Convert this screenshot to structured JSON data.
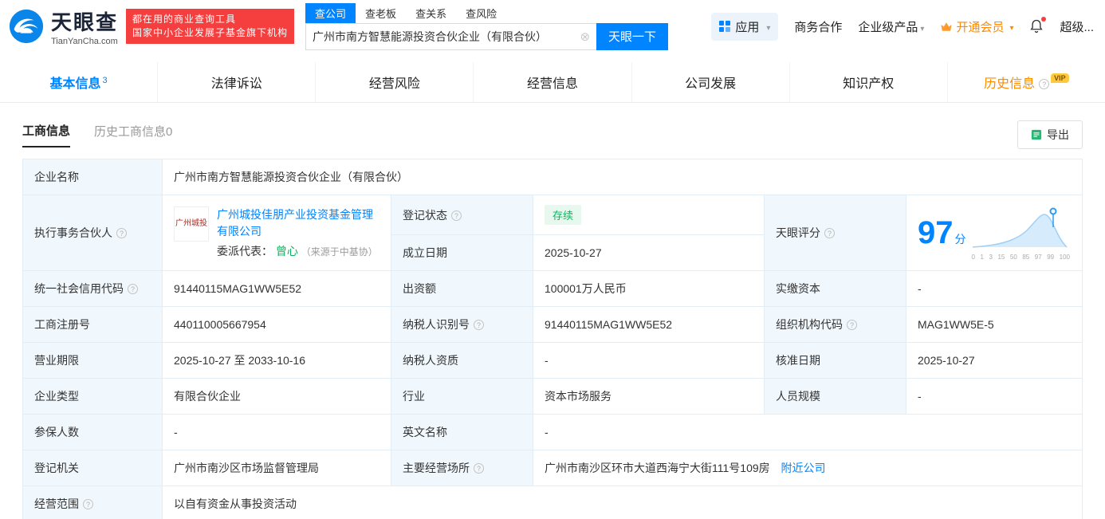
{
  "header": {
    "logo": {
      "name": "天眼查",
      "domain": "TianYanCha.com"
    },
    "slogan1": "都在用的商业查询工具",
    "slogan2": "国家中小企业发展子基金旗下机构",
    "search_tabs": [
      "查公司",
      "查老板",
      "查关系",
      "查风险"
    ],
    "search": {
      "value": "广州市南方智慧能源投资合伙企业（有限合伙）",
      "button": "天眼一下"
    },
    "nav": {
      "apps": "应用",
      "biz_cooperation": "商务合作",
      "enterprise_product": "企业级产品",
      "open_vip": "开通会员",
      "super": "超级..."
    }
  },
  "tabs": [
    {
      "label": "基本信息",
      "count": "3"
    },
    {
      "label": "法律诉讼"
    },
    {
      "label": "经营风险"
    },
    {
      "label": "经营信息"
    },
    {
      "label": "公司发展"
    },
    {
      "label": "知识产权"
    },
    {
      "label": "历史信息",
      "badge": "VIP"
    }
  ],
  "subtabs": [
    "工商信息",
    "历史工商信息0"
  ],
  "export_label": "导出",
  "info": {
    "company_name": {
      "label": "企业名称",
      "value": "广州市南方智慧能源投资合伙企业（有限合伙）"
    },
    "partner": {
      "label": "执行事务合伙人",
      "logo_text": "广州城投",
      "company": "广州城投佳朋产业投资基金管理有限公司",
      "rep_label": "委派代表：",
      "rep_name": "曾心",
      "rep_source": "（来源于中基协）"
    },
    "reg_status": {
      "label": "登记状态",
      "value": "存续"
    },
    "establish_date": {
      "label": "成立日期",
      "value": "2025-10-27"
    },
    "score": {
      "label": "天眼评分",
      "value": "97",
      "unit": "分",
      "axis": [
        "0",
        "1",
        "3",
        "15",
        "50",
        "85",
        "97",
        "99",
        "100"
      ]
    },
    "credit_code": {
      "label": "统一社会信用代码",
      "value": "91440115MAG1WW5E52"
    },
    "capital": {
      "label": "出资额",
      "value": "100001万人民币"
    },
    "paid_capital": {
      "label": "实缴资本",
      "value": "-"
    },
    "reg_number": {
      "label": "工商注册号",
      "value": "440110005667954"
    },
    "taxpayer_id": {
      "label": "纳税人识别号",
      "value": "91440115MAG1WW5E52"
    },
    "org_code": {
      "label": "组织机构代码",
      "value": "MAG1WW5E-5"
    },
    "business_term": {
      "label": "营业期限",
      "value": "2025-10-27 至 2033-10-16"
    },
    "taxpayer_quality": {
      "label": "纳税人资质",
      "value": "-"
    },
    "approval_date": {
      "label": "核准日期",
      "value": "2025-10-27"
    },
    "company_type": {
      "label": "企业类型",
      "value": "有限合伙企业"
    },
    "industry": {
      "label": "行业",
      "value": "资本市场服务"
    },
    "staff_size": {
      "label": "人员规模",
      "value": "-"
    },
    "insured_count": {
      "label": "参保人数",
      "value": "-"
    },
    "english_name": {
      "label": "英文名称",
      "value": "-"
    },
    "reg_authority": {
      "label": "登记机关",
      "value": "广州市南沙区市场监督管理局"
    },
    "business_address": {
      "label": "主要经营场所",
      "value": "广州市南沙区环市大道西海宁大街111号109房",
      "nearby": "附近公司"
    },
    "business_scope": {
      "label": "经营范围",
      "value": "以自有资金从事投资活动"
    }
  },
  "colors": {
    "brand_blue": "#0084ff",
    "badge_red": "#f53f3f",
    "vip_orange": "#ff8a00",
    "status_green": "#12b35f"
  }
}
